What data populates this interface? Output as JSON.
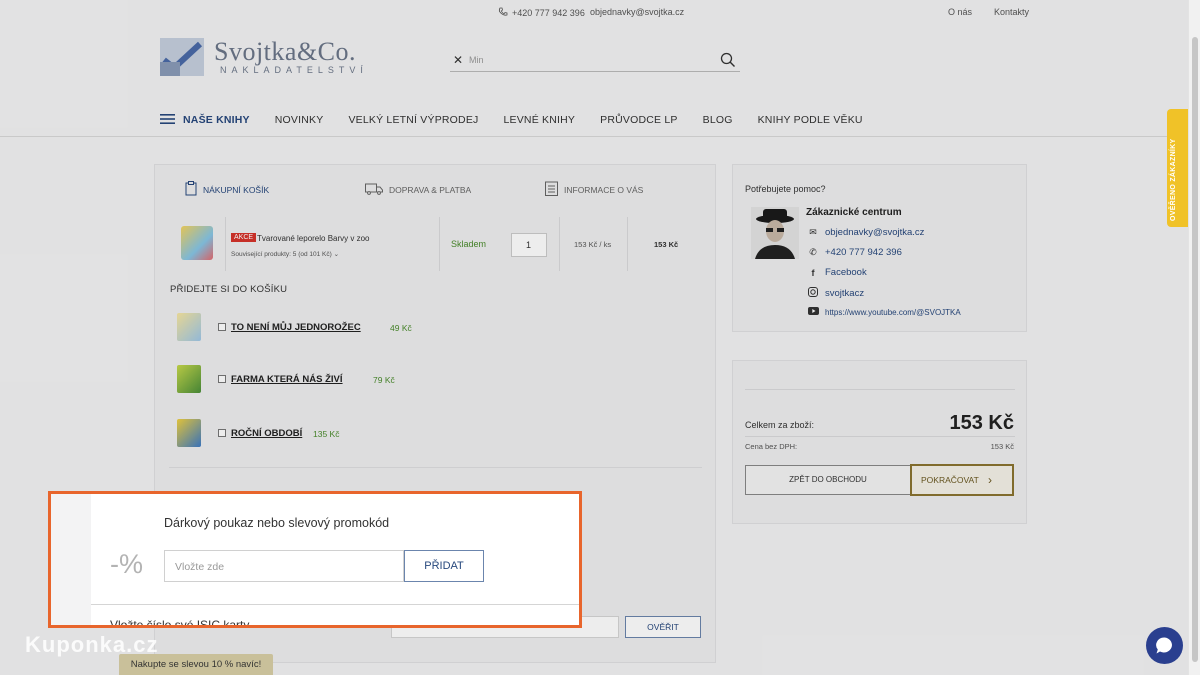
{
  "topbar": {
    "phone": "+420 777 942 396",
    "email": "objednavky@svojtka.cz",
    "about": "O nás",
    "contacts": "Kontakty"
  },
  "logo": {
    "name": "Svojtka&Co.",
    "subtitle": "NAKLADATELSTVÍ"
  },
  "search": {
    "placeholder": "Min"
  },
  "nav": {
    "items": [
      "NAŠE KNIHY",
      "NOVINKY",
      "VELKÝ LETNÍ VÝPRODEJ",
      "LEVNÉ KNIHY",
      "PRŮVODCE LP",
      "BLOG",
      "KNIHY PODLE VĚKU"
    ]
  },
  "steps": [
    "NÁKUPNÍ KOŠÍK",
    "DOPRAVA & PLATBA",
    "INFORMACE O VÁS"
  ],
  "cart": {
    "badge": "AKCE",
    "title": "Tvarované leporelo Barvy v zoo",
    "related": "Související produkty: 5 (od 101 Kč)",
    "stock": "Skladem",
    "qty": "1",
    "unit_price": "153 Kč / ks",
    "total": "153 Kč"
  },
  "add": {
    "heading": "PŘIDEJTE SI DO KOŠÍKU",
    "items": [
      {
        "name": "TO NENÍ MŮJ JEDNOROŽEC",
        "price": "49 Kč"
      },
      {
        "name": "FARMA KTERÁ NÁS ŽIVÍ",
        "price": "79 Kč"
      },
      {
        "name": "ROČNÍ OBDOBÍ",
        "price": "135 Kč"
      }
    ]
  },
  "isic": {
    "verify": "OVĚŘIT"
  },
  "help": {
    "question": "Potřebujete pomoc?",
    "name": "Zákaznické centrum",
    "email": "objednavky@svojtka.cz",
    "phone": "+420 777 942 396",
    "facebook": "Facebook",
    "instagram": "svojtkacz",
    "youtube": "https://www.youtube.com/@SVOJTKA"
  },
  "summary": {
    "total_label": "Celkem za zboží:",
    "total": "153 Kč",
    "vat_label": "Cena bez DPH:",
    "vat": "153 Kč",
    "back": "ZPĚT DO OBCHODU",
    "next": "POKRAČOVAT"
  },
  "voucher": {
    "title": "Dárkový poukaz nebo slevový promokód",
    "percent": "-%",
    "placeholder": "Vložte zde",
    "add": "PŘIDAT",
    "isic_title": "Vložte číslo své ISIC karty"
  },
  "watermark": "Kuponka.cz",
  "promo": "Nakupte se slevou 10 % navíc!",
  "verified": "OVĚŘENO ZÁKAZNÍKY",
  "colors": {
    "accent": "#27487d",
    "highlight": "#e8652c",
    "stock": "#4a8b2c",
    "gold": "#8a7430"
  }
}
